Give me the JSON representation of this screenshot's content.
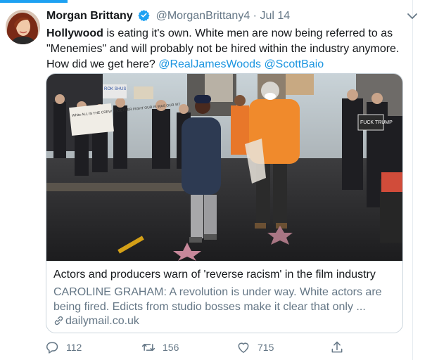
{
  "tweet": {
    "author_name": "Morgan Brittany",
    "handle": "@MorganBrittany4",
    "separator": "·",
    "date": "Jul 14",
    "text_bold": "Hollywood",
    "text_body": " is eating it's own. White men are now being referred to as \"Menemies\" and will probably not be hired within the industry anymore. How did we get here? ",
    "mention_1": "@RealJamesWoods",
    "mention_2": "@ScottBaio"
  },
  "image_signs": {
    "sign_1": "White ALL IN THE CREW TOGETHER FIGHT OUR IS WAS OUR SIT",
    "sign_2": "ROK SHUS",
    "sign_3": "FUCK TRUMP"
  },
  "card": {
    "title": "Actors and producers warn of 'reverse racism' in the film industry",
    "description": "CAROLINE GRAHAM: A revolution is under way. White actors are being fired. Edicts from studio bosses make it clear that only ...",
    "domain": "dailymail.co.uk"
  },
  "actions": {
    "replies": "112",
    "retweets": "156",
    "likes": "715"
  },
  "colors": {
    "link": "#1b95e0",
    "secondary_text": "#657786",
    "verified": "#1da1f2",
    "border": "#ccd6dd"
  }
}
